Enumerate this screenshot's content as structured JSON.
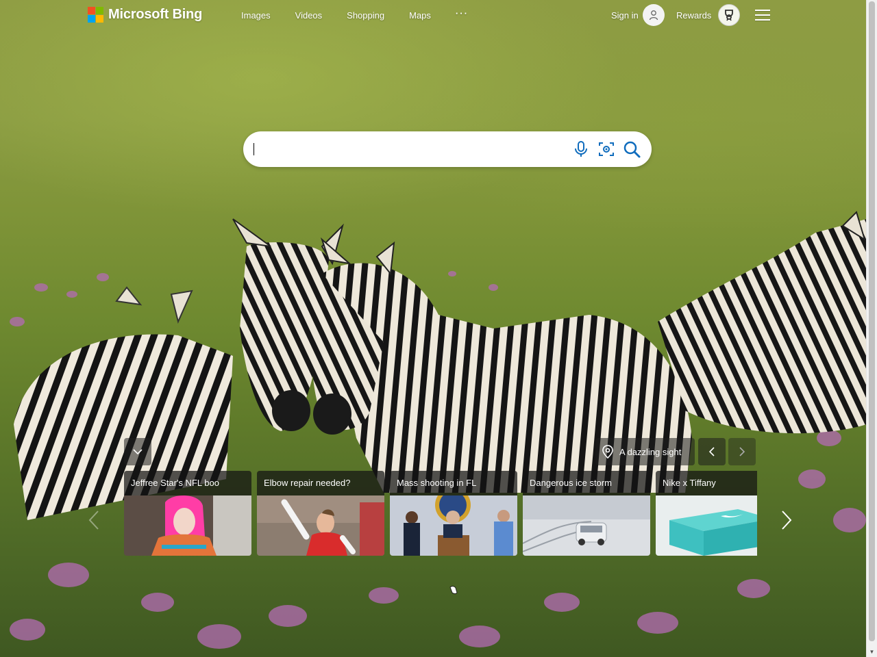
{
  "brand": {
    "name": "Microsoft Bing",
    "logo_colors": [
      "#f25022",
      "#7fba00",
      "#00a4ef",
      "#ffb900"
    ]
  },
  "nav": {
    "items": [
      {
        "label": "Images"
      },
      {
        "label": "Videos"
      },
      {
        "label": "Shopping"
      },
      {
        "label": "Maps"
      }
    ],
    "more_label": "···"
  },
  "account": {
    "signin_label": "Sign in",
    "rewards_label": "Rewards"
  },
  "search": {
    "value": "",
    "placeholder": "",
    "icons": [
      "microphone-icon",
      "visual-search-icon",
      "search-icon"
    ]
  },
  "image_of_day": {
    "label": "A dazzling sight",
    "icon": "location-pin-icon"
  },
  "cards": [
    {
      "title": "Jeffree Star's NFL boo",
      "icon": "news-thumbnail"
    },
    {
      "title": "Elbow repair needed?",
      "icon": "news-thumbnail"
    },
    {
      "title": "Mass shooting in FL",
      "icon": "news-thumbnail"
    },
    {
      "title": "Dangerous ice storm",
      "icon": "news-thumbnail"
    },
    {
      "title": "Nike x Tiffany",
      "icon": "news-thumbnail"
    }
  ],
  "colors": {
    "accent": "#0078d4",
    "search_icon_blue": "#0f6cbd",
    "tiffany": "#3ec0c0"
  }
}
